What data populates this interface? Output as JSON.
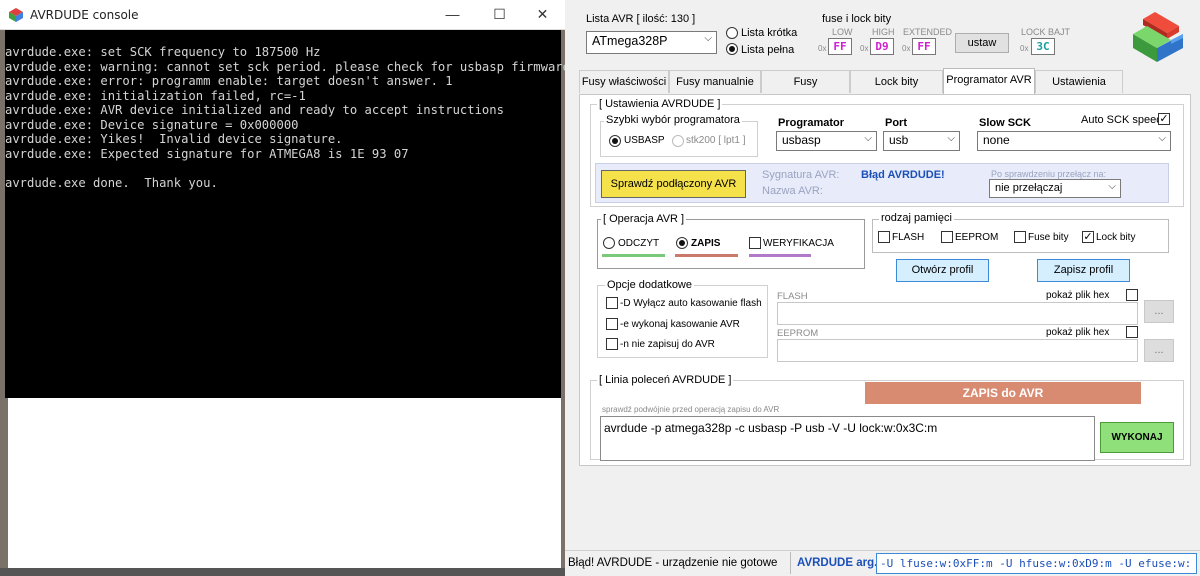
{
  "console": {
    "title": "AVRDUDE console",
    "controls": {
      "minimize": "—",
      "maximize": "☐",
      "close": "✕"
    },
    "lines": [
      "avrdude.exe: set SCK frequency to 187500 Hz",
      "avrdude.exe: warning: cannot set sck period. please check for usbasp firmware update.",
      "avrdude.exe: error: programm enable: target doesn't answer. 1",
      "avrdude.exe: initialization failed, rc=-1",
      "avrdude.exe: AVR device initialized and ready to accept instructions",
      "avrdude.exe: Device signature = 0x000000",
      "avrdude.exe: Yikes!  Invalid device signature.",
      "avrdude.exe: Expected signature for ATMEGA8 is 1E 93 07",
      "",
      "avrdude.exe done.  Thank you."
    ]
  },
  "app": {
    "avr_list": {
      "label": "Lista AVR [ ilość: 130 ]",
      "selected": "ATmega328P",
      "short_list": "Lista krótka",
      "full_list": "Lista pełna"
    },
    "fuses": {
      "label": "fuse i lock bity",
      "low_label": "LOW",
      "low_value": "FF",
      "high_label": "HIGH",
      "high_value": "D9",
      "ext_label": "EXTENDED",
      "ext_value": "FF",
      "set_button": "ustaw",
      "lock_label": "LOCK BAJT",
      "lock_value": "3C",
      "hex_prefix": "0x"
    },
    "tabs": [
      "Fusy właściwości",
      "Fusy manualnie",
      "Fusy uproszczone",
      "Lock bity",
      "Programator AVR",
      "Ustawienia"
    ],
    "settings": {
      "group_label": "[ Ustawienia AVRDUDE ]",
      "quick_label": "Szybki wybór programatora",
      "usbasp": "USBASP",
      "stk200": "stk200 [ lpt1 ]",
      "programmer_label": "Programator",
      "programmer_value": "usbasp",
      "port_label": "Port",
      "port_value": "usb",
      "slow_label": "Slow SCK",
      "slow_value": "none",
      "auto_sck": "Auto SCK speed",
      "check_button": "Sprawdź podłączony AVR",
      "signature_label": "Sygnatura AVR:",
      "name_label": "Nazwa AVR:",
      "error_text": "Błąd AVRDUDE!",
      "switch_label": "Po sprawdzeniu przełącz na:",
      "switch_value": "nie przełączaj"
    },
    "operation": {
      "group_label": "[ Operacja AVR ]",
      "read": "ODCZYT",
      "write": "ZAPIS",
      "verify": "WERYFIKACJA",
      "colors": {
        "read": "#7ac97a",
        "write": "#c97a6a",
        "verify": "#b07ac9"
      }
    },
    "memory": {
      "group_label": "rodzaj pamięci",
      "flash": "FLASH",
      "eeprom": "EEPROM",
      "fuse": "Fuse bity",
      "lock": "Lock bity",
      "open_profile": "Otwórz profil",
      "save_profile": "Zapisz profil"
    },
    "options": {
      "group_label": "Opcje dodatkowe",
      "opt1": "-D Wyłącz auto kasowanie flash",
      "opt2": "-e wykonaj kasowanie AVR",
      "opt3": "-n nie zapisuj do AVR"
    },
    "files": {
      "flash_label": "FLASH",
      "eeprom_label": "EEPROM",
      "show_hex": "pokaż plik hex",
      "browse": "..."
    },
    "command": {
      "group_label": "[ Linia poleceń AVRDUDE ]",
      "banner": "ZAPIS do AVR",
      "banner_color": "#d98b72",
      "hint": "sprawdź podwójnie przed operacją zapisu do AVR",
      "text": "avrdude -p atmega328p -c usbasp -P usb -V  -U lock:w:0x3C:m",
      "execute": "WYKONAJ"
    },
    "status": {
      "message": "Błąd! AVRDUDE - urządzenie nie gotowe",
      "args_label": "AVRDUDE arg.",
      "args_value": "-U lfuse:w:0xFF:m  -U hfuse:w:0xD9:m  -U efuse:w:"
    }
  }
}
